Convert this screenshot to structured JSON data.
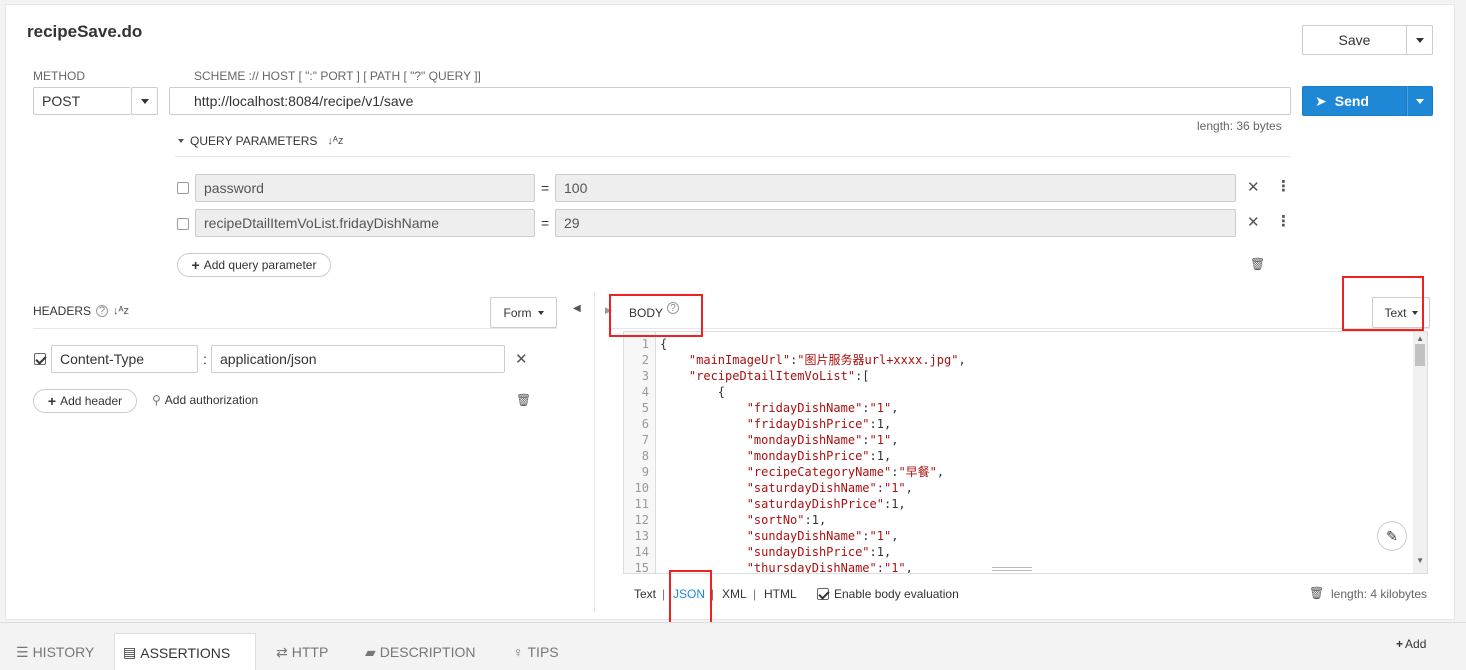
{
  "request": {
    "title": "recipeSave.do",
    "save_label": "Save",
    "method_label": "METHOD",
    "method_value": "POST",
    "url_label": "SCHEME :// HOST [ \":\" PORT ] [ PATH [ \"?\" QUERY ]]",
    "url_value": "http://localhost:8084/recipe/v1/save",
    "send_label": "Send",
    "url_length": "length: 36 bytes"
  },
  "query": {
    "section_label": "QUERY PARAMETERS",
    "params": [
      {
        "name": "password",
        "value": "100"
      },
      {
        "name": "recipeDtailItemVoList.fridayDishName",
        "value": "29"
      }
    ],
    "equals": "=",
    "add_label": "Add query parameter"
  },
  "headers": {
    "section_label": "HEADERS",
    "form_label": "Form",
    "items": [
      {
        "name": "Content-Type",
        "value": "application/json"
      }
    ],
    "colon": ":",
    "add_label": "Add header",
    "auth_label": "Add authorization"
  },
  "body": {
    "section_label": "BODY",
    "type_label": "Text",
    "line_numbers": [
      "1",
      "2",
      "3",
      "4",
      "5",
      "6",
      "7",
      "8",
      "9",
      "10",
      "11",
      "12",
      "13",
      "14",
      "15"
    ],
    "lines": [
      "{",
      "    \"mainImageUrl\":\"图片服务器url+xxxx.jpg\",",
      "    \"recipeDtailItemVoList\":[",
      "        {",
      "            \"fridayDishName\":\"1\",",
      "            \"fridayDishPrice\":1,",
      "            \"mondayDishName\":\"1\",",
      "            \"mondayDishPrice\":1,",
      "            \"recipeCategoryName\":\"早餐\",",
      "            \"saturdayDishName\":\"1\",",
      "            \"saturdayDishPrice\":1,",
      "            \"sortNo\":1,",
      "            \"sundayDishName\":\"1\",",
      "            \"sundayDishPrice\":1,",
      "            \"thursdayDishName\":\"1\","
    ],
    "formats": [
      "Text",
      "JSON",
      "XML",
      "HTML"
    ],
    "separator": "|",
    "eval_label": "Enable body evaluation",
    "length": "length: 4 kilobytes"
  },
  "bottom_tabs": [
    {
      "label": "HISTORY",
      "icon": "list-icon"
    },
    {
      "label": "ASSERTIONS",
      "icon": "assertions-icon"
    },
    {
      "label": "HTTP",
      "icon": "exchange-icon"
    },
    {
      "label": "DESCRIPTION",
      "icon": "book-icon"
    },
    {
      "label": "TIPS",
      "icon": "lightbulb-icon"
    }
  ],
  "bottom_add_label": "Add",
  "colors": {
    "primary": "#1e88d6",
    "annotation": "#e22222"
  }
}
